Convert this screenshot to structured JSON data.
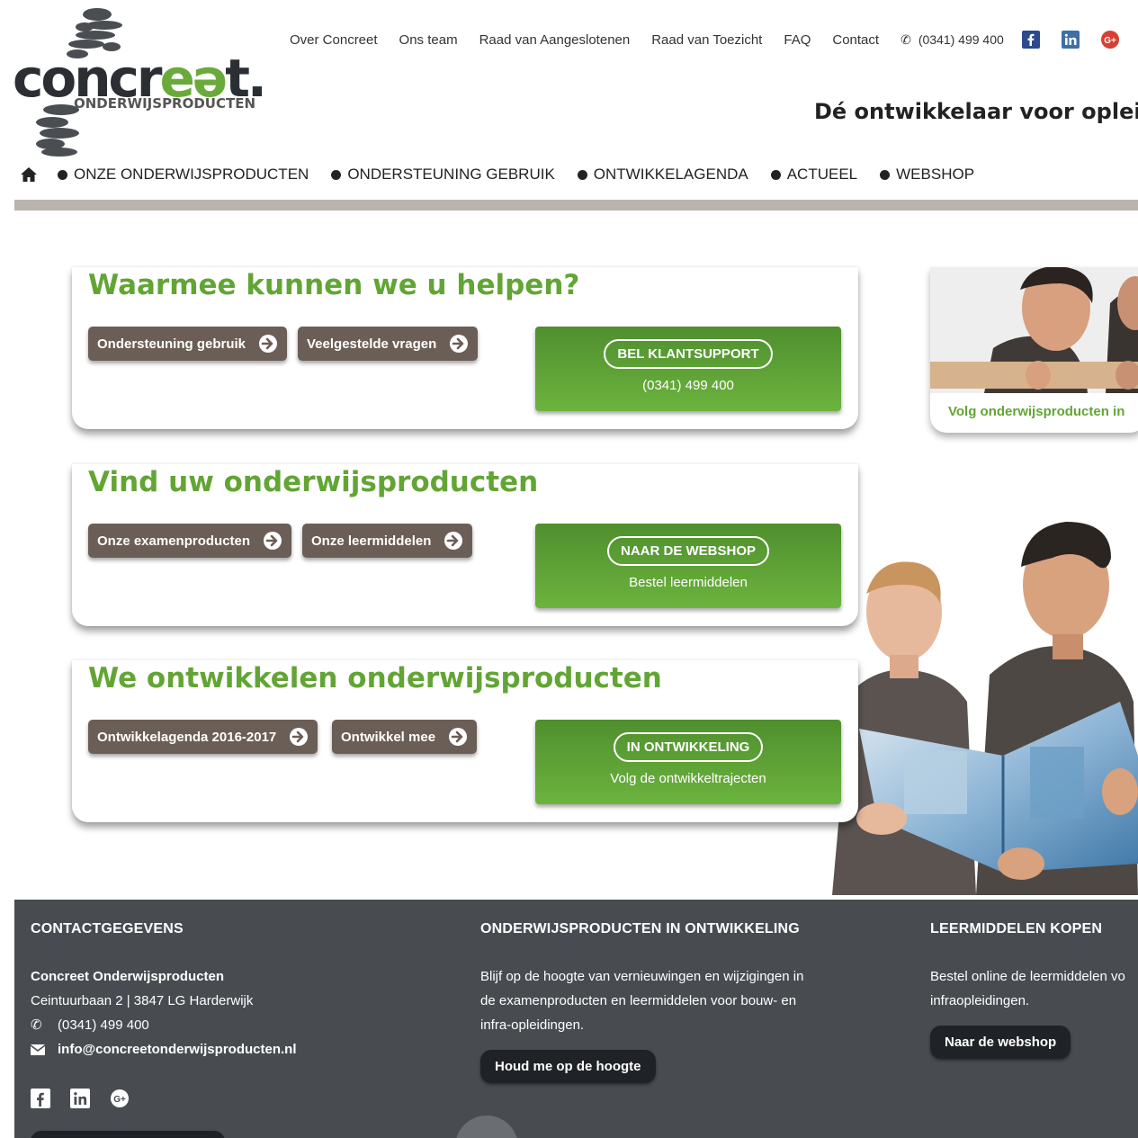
{
  "logo": {
    "wordmark_prefix": "concr",
    "wordmark_e": "eə",
    "wordmark_suffix": "t.",
    "tagline": "ONDERWIJSPRODUCTEN"
  },
  "topnav": {
    "links": [
      "Over Concreet",
      "Ons team",
      "Raad van Aangeslotenen",
      "Raad van Toezicht",
      "FAQ",
      "Contact"
    ],
    "phone": "(0341) 499 400"
  },
  "slogan": "Dé ontwikkelaar voor opleider",
  "mainnav": {
    "items": [
      "ONZE ONDERWIJSPRODUCTEN",
      "ONDERSTEUNING GEBRUIK",
      "ONTWIKKELAGENDA",
      "ACTUEEL",
      "WEBSHOP"
    ]
  },
  "cards": [
    {
      "title": "Waarmee kunnen we u helpen?",
      "buttons": [
        "Ondersteuning gebruik",
        "Veelgestelde vragen"
      ],
      "cta_badge": "BEL KLANTSUPPORT",
      "cta_sub": "(0341) 499 400"
    },
    {
      "title": "Vind uw onderwijsproducten",
      "buttons": [
        "Onze examenproducten",
        "Onze leermiddelen"
      ],
      "cta_badge": "NAAR DE WEBSHOP",
      "cta_sub": "Bestel leermiddelen"
    },
    {
      "title": "We ontwikkelen onderwijsproducten",
      "buttons": [
        "Ontwikkelagenda 2016-2017",
        "Ontwikkel mee"
      ],
      "cta_badge": "IN ONTWIKKELING",
      "cta_sub": "Volg de ontwikkeltrajecten"
    }
  ],
  "side_card": {
    "caption": "Volg onderwijsproducten in"
  },
  "footer": {
    "contact": {
      "heading": "CONTACTGEGEVENS",
      "company": "Concreet Onderwijsproducten",
      "address": "Ceintuurbaan 2  |  3847 LG Harderwijk",
      "phone": "(0341) 499 400",
      "email": "info@concreetonderwijsproducten.nl"
    },
    "development": {
      "heading": "ONDERWIJSPRODUCTEN IN ONTWIKKELING",
      "text_lines": [
        "Blijf op de hoogte van vernieuwingen en wijzigingen in",
        "de examenproducten en leermiddelen voor bouw- en",
        "infra-opleidingen."
      ],
      "button": "Houd me op de hoogte"
    },
    "shop": {
      "heading": "LEERMIDDELEN KOPEN",
      "text_lines": [
        "Bestel online de leermiddelen vo",
        "infraopleidingen."
      ],
      "button": "Naar de webshop"
    }
  },
  "colors": {
    "green": "#62a534",
    "button_brown": "#6b5e56",
    "footer_bg": "#484c51"
  }
}
